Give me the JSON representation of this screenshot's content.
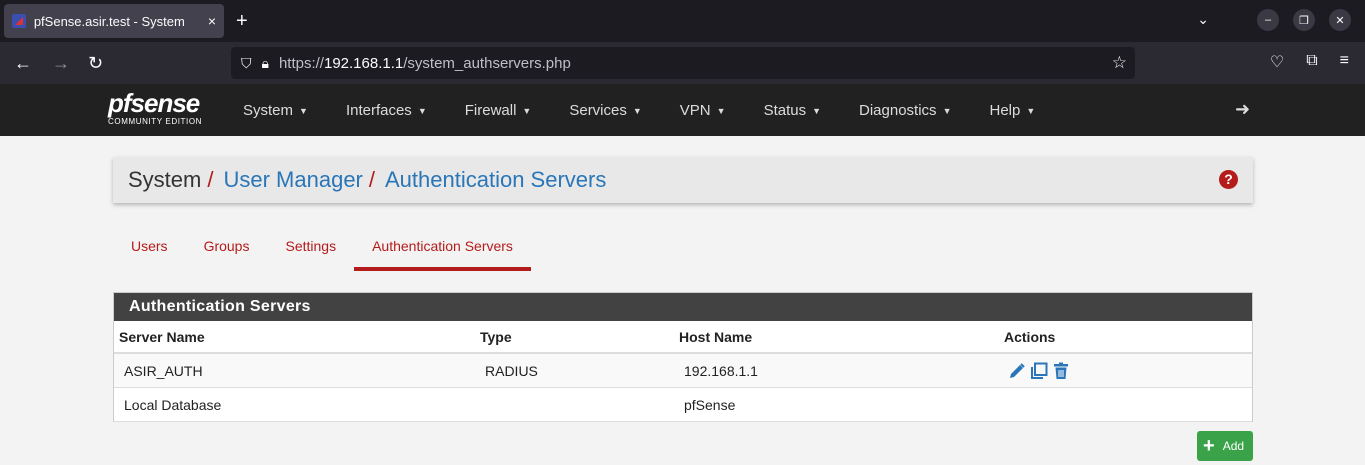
{
  "browser": {
    "tab_title": "pfSense.asir.test - System",
    "tab_close": "×",
    "new_tab": "+",
    "url_prefix": "https://",
    "url_host": "192.168.1.1",
    "url_path": "/system_authservers.php"
  },
  "header": {
    "logo_text": "pfsense",
    "logo_sub": "COMMUNITY EDITION",
    "menu": [
      {
        "label": "System"
      },
      {
        "label": "Interfaces"
      },
      {
        "label": "Firewall"
      },
      {
        "label": "Services"
      },
      {
        "label": "VPN"
      },
      {
        "label": "Status"
      },
      {
        "label": "Diagnostics"
      },
      {
        "label": "Help"
      }
    ]
  },
  "breadcrumb": {
    "root": "System",
    "level1": "User Manager",
    "level2": "Authentication Servers",
    "separator": "/"
  },
  "tabs": [
    {
      "label": "Users"
    },
    {
      "label": "Groups"
    },
    {
      "label": "Settings"
    },
    {
      "label": "Authentication Servers",
      "active": true
    }
  ],
  "panel": {
    "title": "Authentication Servers",
    "columns": [
      "Server Name",
      "Type",
      "Host Name",
      "Actions"
    ],
    "rows": [
      {
        "name": "ASIR_AUTH",
        "type": "RADIUS",
        "host": "192.168.1.1",
        "actions": [
          "edit-icon",
          "copy-icon",
          "trash-icon"
        ]
      },
      {
        "name": "Local Database",
        "type": "",
        "host": "pfSense",
        "actions": []
      }
    ]
  },
  "add_button": {
    "label": "Add",
    "icon": "plus-icon"
  },
  "colors": {
    "accent": "#b41b1b",
    "link": "#2a76b8",
    "header_bg": "#212121",
    "add_green": "#3aa34a"
  }
}
